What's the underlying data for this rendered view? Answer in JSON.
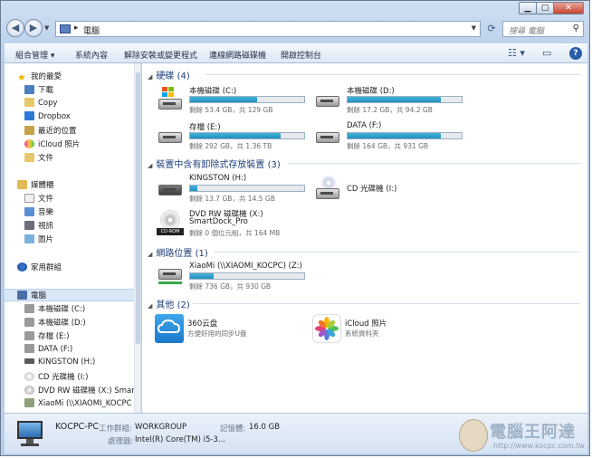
{
  "window": {
    "controls": {
      "minimize": "▁",
      "maximize": "▢",
      "close": "✕"
    }
  },
  "address": {
    "path": "電腦",
    "search_placeholder": "搜尋 電腦"
  },
  "toolbar": {
    "organize": "組合管理 ▾",
    "properties": "系統內容",
    "uninstall": "解除安裝或變更程式",
    "map_drive": "連線網路磁碟機",
    "control_panel": "開啟控制台"
  },
  "nav": {
    "favorites": "我的最愛",
    "downloads": "下載",
    "copy": "Copy",
    "dropbox": "Dropbox",
    "recent": "最近的位置",
    "icloud": "iCloud 照片",
    "docs": "文件",
    "libraries": "媒體櫃",
    "lib_docs": "文件",
    "lib_music": "音樂",
    "lib_video": "視訊",
    "lib_pics": "圖片",
    "homegroup": "家用群組",
    "computer": "電腦",
    "drive_c": "本機磁碟 (C:)",
    "drive_d": "本機磁碟 (D:)",
    "drive_e": "存檔 (E:)",
    "drive_f": "DATA (F:)",
    "drive_h": "KINGSTON (H:)",
    "drive_i": "CD 光碟機 (I:)",
    "drive_x": "DVD RW 磁碟機 (X:) SmartI",
    "drive_z": "XiaoMi (\\\\XIAOMI_KOCPC"
  },
  "groups": {
    "hdd": "硬碟 (4)",
    "removable": "裝置中含有卸除式存放裝置 (3)",
    "network": "網路位置 (1)",
    "other": "其他 (2)"
  },
  "drives": {
    "c": {
      "name": "本機磁碟 (C:)",
      "free": "剩餘 53.4 GB，共 129 GB",
      "used_fraction": 0.59
    },
    "d": {
      "name": "本機磁碟 (D:)",
      "free": "剩餘 17.2 GB，共 94.2 GB",
      "used_fraction": 0.82
    },
    "e": {
      "name": "存檔 (E:)",
      "free": "剩餘 292 GB，共 1.36 TB",
      "used_fraction": 0.79
    },
    "f": {
      "name": "DATA (F:)",
      "free": "剩餘 164 GB，共 931 GB",
      "used_fraction": 0.82
    },
    "h": {
      "name": "KINGSTON (H:)",
      "free": "剩餘 13.7 GB，共 14.5 GB",
      "used_fraction": 0.06
    },
    "i": {
      "name": "CD 光碟機 (I:)"
    },
    "x": {
      "name": "DVD RW 磁碟機 (X:)",
      "name2": "SmartDock_Pro",
      "free": "剩餘 0 個位元組，共 164 MB"
    },
    "z": {
      "name": "XiaoMi (\\\\XIAOMI_KOCPC) (Z:)",
      "free": "剩餘 736 GB，共 930 GB",
      "used_fraction": 0.21
    }
  },
  "other": {
    "cloud360": {
      "name": "360云盘",
      "desc": "方便好用的同步U盘"
    },
    "icloud": {
      "name": "iCloud 照片",
      "desc": "系統資料夾"
    }
  },
  "status": {
    "pc_name": "KOCPC-PC",
    "workgroup_label": "工作群組:",
    "workgroup": "WORKGROUP",
    "memory_label": "記憶體:",
    "memory": "16.0 GB",
    "cpu_label": "處理器:",
    "cpu": "Intel(R) Core(TM) i5-3..."
  },
  "watermark": {
    "text": "電腦王阿達",
    "url": "http://www.kocpc.com.tw"
  }
}
